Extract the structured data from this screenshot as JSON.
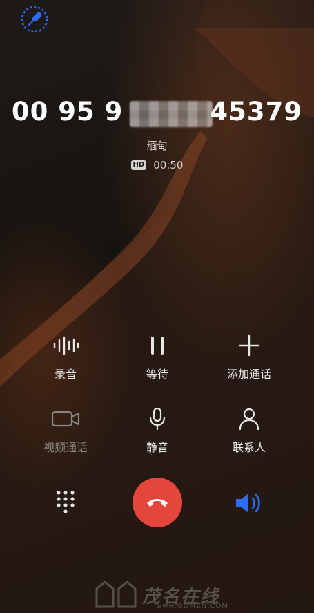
{
  "call": {
    "number_prefix": "00 95 9",
    "number_suffix": "45379",
    "location": "缅甸",
    "hd_label": "HD",
    "duration": "00:50"
  },
  "controls": {
    "record": {
      "label": "录音",
      "icon": "waveform-icon"
    },
    "hold": {
      "label": "等待",
      "icon": "pause-icon"
    },
    "add_call": {
      "label": "添加通话",
      "icon": "plus-icon"
    },
    "video_call": {
      "label": "视频通话",
      "icon": "video-camera-icon"
    },
    "mute": {
      "label": "静音",
      "icon": "microphone-icon"
    },
    "contacts": {
      "label": "联系人",
      "icon": "person-icon"
    }
  },
  "bottom_bar": {
    "keypad_icon": "dialpad-icon",
    "end_call_icon": "hang-up-icon",
    "speaker_icon": "speaker-icon"
  },
  "watermark": {
    "title": "茂名在线",
    "url": "www.GDMZN.COM"
  },
  "colors": {
    "end_call": "#e4463c",
    "speaker_active": "#2f6cf6",
    "record_indicator": "#2f6cf6"
  }
}
